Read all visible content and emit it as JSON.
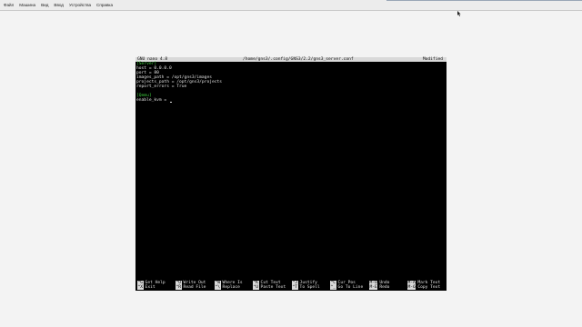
{
  "vm_menu": [
    "Файл",
    "Машина",
    "Вид",
    "Ввод",
    "Устройства",
    "Справка"
  ],
  "nano": {
    "version": "GNU nano 4.8",
    "file_path": "/home/gns3/.config/GNS3/2.2/gns3_server.conf",
    "status": "Modified"
  },
  "file_lines": [
    "[Server]",
    "host = 0.0.0.0",
    "port = 80",
    "images_path = /opt/gns3/images",
    "projects_path = /opt/gns3/projects",
    "report_errors = True",
    "",
    "[Qemu]",
    "enable_kvm = "
  ],
  "shortcuts_row1": [
    {
      "key": "^G",
      "label": "Get Help"
    },
    {
      "key": "^O",
      "label": "Write Out"
    },
    {
      "key": "^W",
      "label": "Where Is"
    },
    {
      "key": "^K",
      "label": "Cut Text"
    },
    {
      "key": "^J",
      "label": "Justify"
    },
    {
      "key": "^C",
      "label": "Cur Pos"
    },
    {
      "key": "M-U",
      "label": "Undo"
    },
    {
      "key": "M-A",
      "label": "Mark Text"
    }
  ],
  "shortcuts_row2": [
    {
      "key": "^X",
      "label": "Exit"
    },
    {
      "key": "^R",
      "label": "Read File"
    },
    {
      "key": "^\\",
      "label": "Replace"
    },
    {
      "key": "^U",
      "label": "Paste Text"
    },
    {
      "key": "^T",
      "label": "To Spell"
    },
    {
      "key": "^_",
      "label": "Go To Line"
    },
    {
      "key": "M-E",
      "label": "Redo"
    },
    {
      "key": "M-6",
      "label": "Copy Text"
    }
  ],
  "colors": {
    "terminal_bg": "#000000",
    "terminal_fg": "#e0e0e0",
    "section_header": "#3fd13f",
    "bar_bg": "#d9d9d9"
  }
}
